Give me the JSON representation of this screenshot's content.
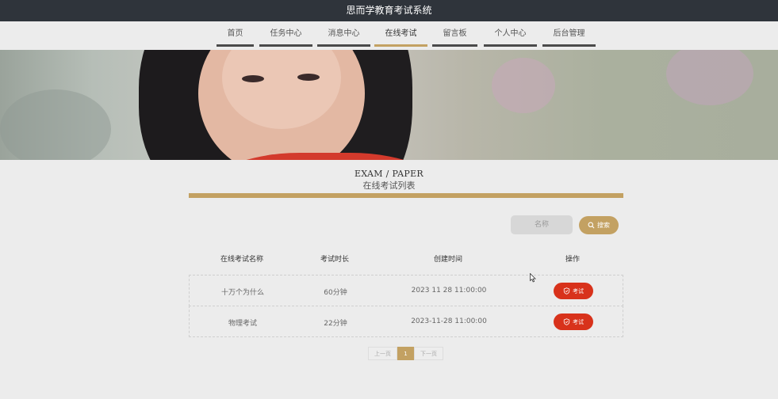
{
  "header": {
    "title": "思而学教育考试系统"
  },
  "nav": {
    "items": [
      {
        "label": "首页"
      },
      {
        "label": "任务中心"
      },
      {
        "label": "消息中心"
      },
      {
        "label": "在线考试",
        "active": true
      },
      {
        "label": "留言板"
      },
      {
        "label": "个人中心"
      },
      {
        "label": "后台管理"
      }
    ]
  },
  "section": {
    "title_en": "EXAM / PAPER",
    "title_cn": "在线考试列表"
  },
  "search": {
    "placeholder": "名称",
    "button_label": "搜索",
    "button_icon": "search-icon"
  },
  "table": {
    "headers": [
      "在线考试名称",
      "考试时长",
      "创建时间",
      "操作"
    ],
    "rows": [
      {
        "name": "十万个为什么",
        "duration": "60分钟",
        "created": "2023 11 28 11:00:00",
        "action": "考试"
      },
      {
        "name": "物理考试",
        "duration": "22分钟",
        "created": "2023-11-28 11:00:00",
        "action": "考试"
      }
    ]
  },
  "pagination": {
    "prev": "上一页",
    "current": "1",
    "next": "下一页"
  },
  "colors": {
    "topbar": "#2f343b",
    "accent_gold": "#c3a162",
    "exam_button": "#d8321b"
  }
}
